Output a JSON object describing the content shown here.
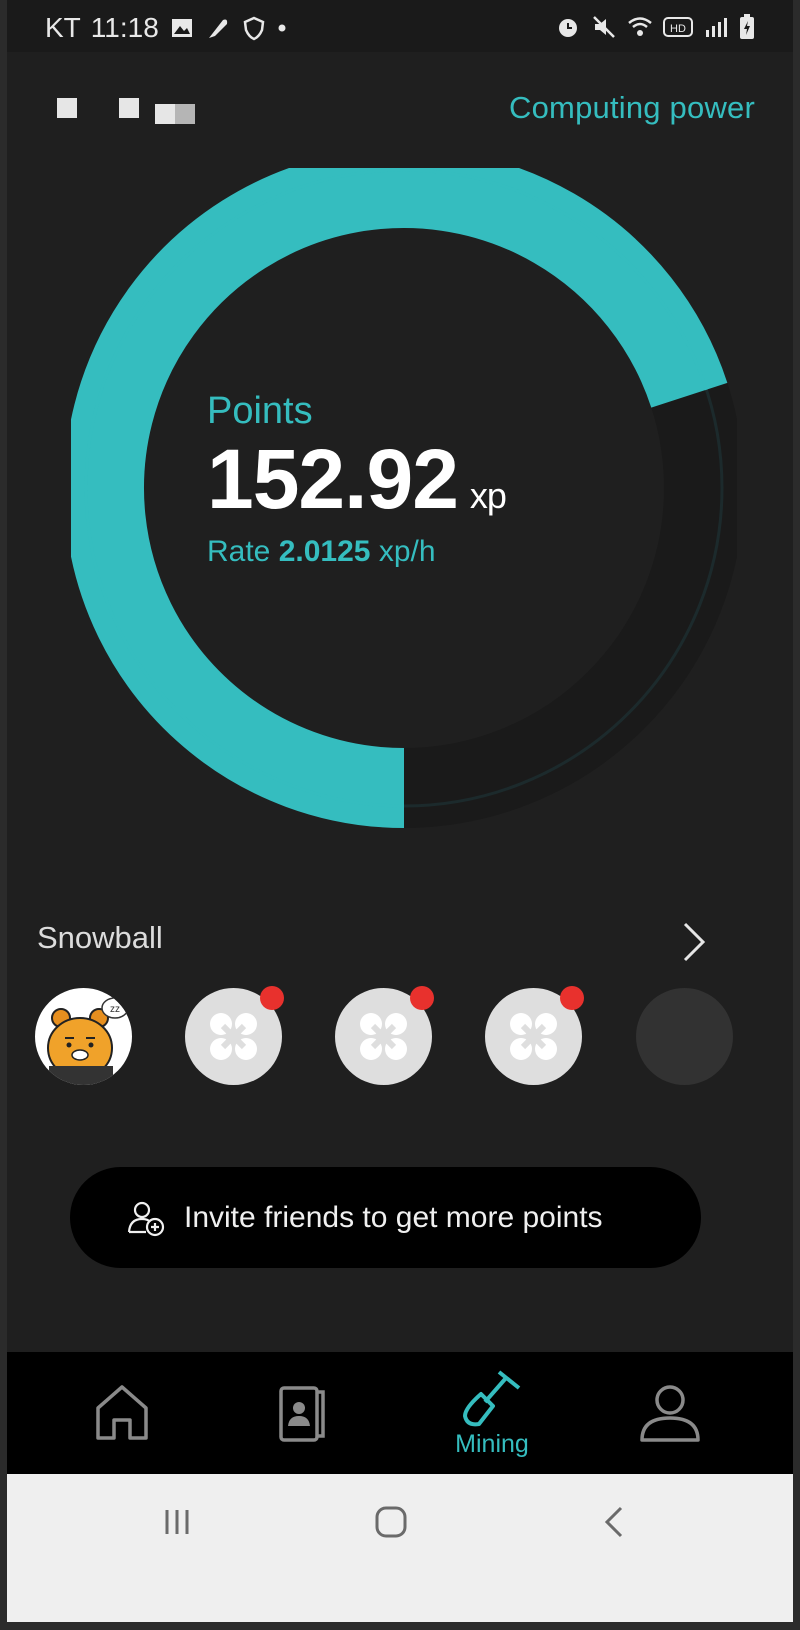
{
  "status_bar": {
    "carrier": "KT",
    "time": "11:18",
    "left_icons": [
      "image-icon",
      "feather-icon",
      "shield-icon",
      "dot-icon"
    ],
    "right_icons": [
      "alarm-icon",
      "mute-icon",
      "wifi-icon",
      "hd-icon",
      "signal-icon",
      "battery-charging-icon"
    ]
  },
  "header": {
    "computing_power_label": "Computing power"
  },
  "mining": {
    "points_label": "Points",
    "points_value": "152.92",
    "points_unit": "xp",
    "rate_label": "Rate",
    "rate_value": "2.0125",
    "rate_unit": "xp/h",
    "progress_fraction": 0.7,
    "ring_color": "#35bdbf"
  },
  "snowball": {
    "title": "Snowball",
    "members": [
      {
        "type": "user-avatar",
        "icon": "kakao-bear-avatar"
      },
      {
        "type": "app-placeholder",
        "icon": "network-icon",
        "has_badge": true
      },
      {
        "type": "app-placeholder",
        "icon": "network-icon",
        "has_badge": true
      },
      {
        "type": "app-placeholder",
        "icon": "network-icon",
        "has_badge": true
      },
      {
        "type": "empty-slot"
      }
    ]
  },
  "invite": {
    "label": "Invite friends to get more points",
    "icon": "add-user-icon"
  },
  "bottom_nav": {
    "items": [
      {
        "icon": "home-icon",
        "label": "",
        "active": false
      },
      {
        "icon": "contacts-icon",
        "label": "",
        "active": false
      },
      {
        "icon": "shovel-icon",
        "label": "Mining",
        "active": true
      },
      {
        "icon": "profile-icon",
        "label": "",
        "active": false
      }
    ]
  },
  "system_nav": {
    "icons": [
      "recents-icon",
      "home-button-icon",
      "back-icon"
    ]
  },
  "colors": {
    "accent": "#35bdbf",
    "background": "#1f1f1f",
    "badge": "#e8312d"
  }
}
